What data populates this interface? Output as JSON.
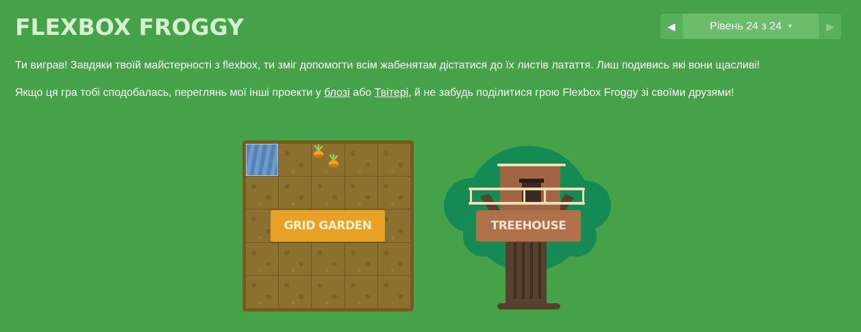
{
  "header": {
    "title": "FLEXBOX FROGGY"
  },
  "level_nav": {
    "prev_icon": "triangle-left-icon",
    "next_icon": "triangle-right-icon",
    "prev_glyph": "◀",
    "next_glyph": "▶",
    "level_text": "Рівень 24 з 24",
    "caret_glyph": "▾"
  },
  "content": {
    "win_message": "Ти виграв! Завдяки твоїй майстерності з flexbox, ти зміг допомогти всім жабенятам дістатися до їх листів латаття. Лиш подивись які вони щасливі!",
    "promo_before": "Якщо ця гра тобі сподобалась, переглянь мої інші проекти у ",
    "blog_link": "блозі",
    "promo_middle": " або ",
    "twitter_link": "Твітері",
    "promo_after": ", й не забудь поділитися грою Flexbox Froggy зі своїми друзями!"
  },
  "projects": {
    "grid_garden_label": "GRID GARDEN",
    "treehouse_label": "TREEHOUSE"
  },
  "colors": {
    "background": "#45a249",
    "title": "#d5f0cf",
    "grid_garden_button": "#e7a226",
    "treehouse_button": "#b0714a",
    "garden_soil": "#8b7030",
    "tree_foliage": "#158a52"
  }
}
